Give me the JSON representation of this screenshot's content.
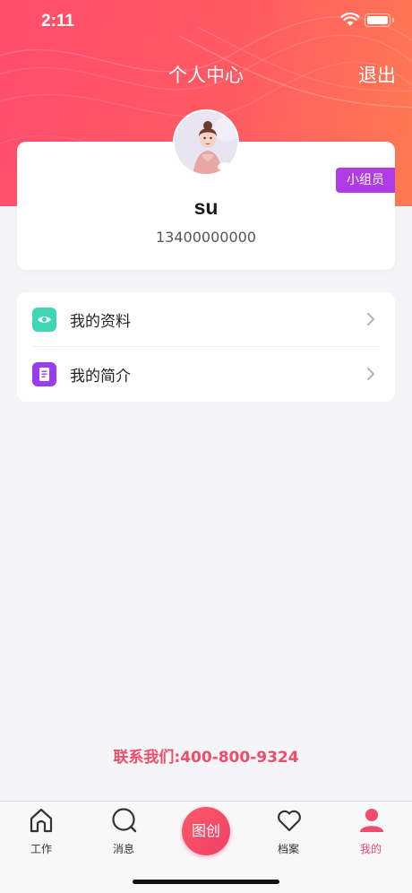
{
  "status": {
    "time": "2:11"
  },
  "header": {
    "title": "个人中心",
    "logout_label": "退出"
  },
  "profile": {
    "name": "su",
    "phone": "13400000000",
    "role_badge": "小组员"
  },
  "menu": [
    {
      "label": "我的资料",
      "icon": "eye-icon",
      "color": "#3fd6b6"
    },
    {
      "label": "我的简介",
      "icon": "document-icon",
      "color": "#9b3cf0"
    }
  ],
  "contact": "联系我们:400-800-9324",
  "tabbar": {
    "tabs": [
      {
        "label": "工作",
        "icon": "home-icon"
      },
      {
        "label": "消息",
        "icon": "chat-bubble-icon"
      },
      {
        "label": "图创",
        "icon": "center-action"
      },
      {
        "label": "档案",
        "icon": "heart-icon"
      },
      {
        "label": "我的",
        "icon": "person-icon"
      }
    ],
    "active_index": 4,
    "accent": "#ef4b6c"
  }
}
